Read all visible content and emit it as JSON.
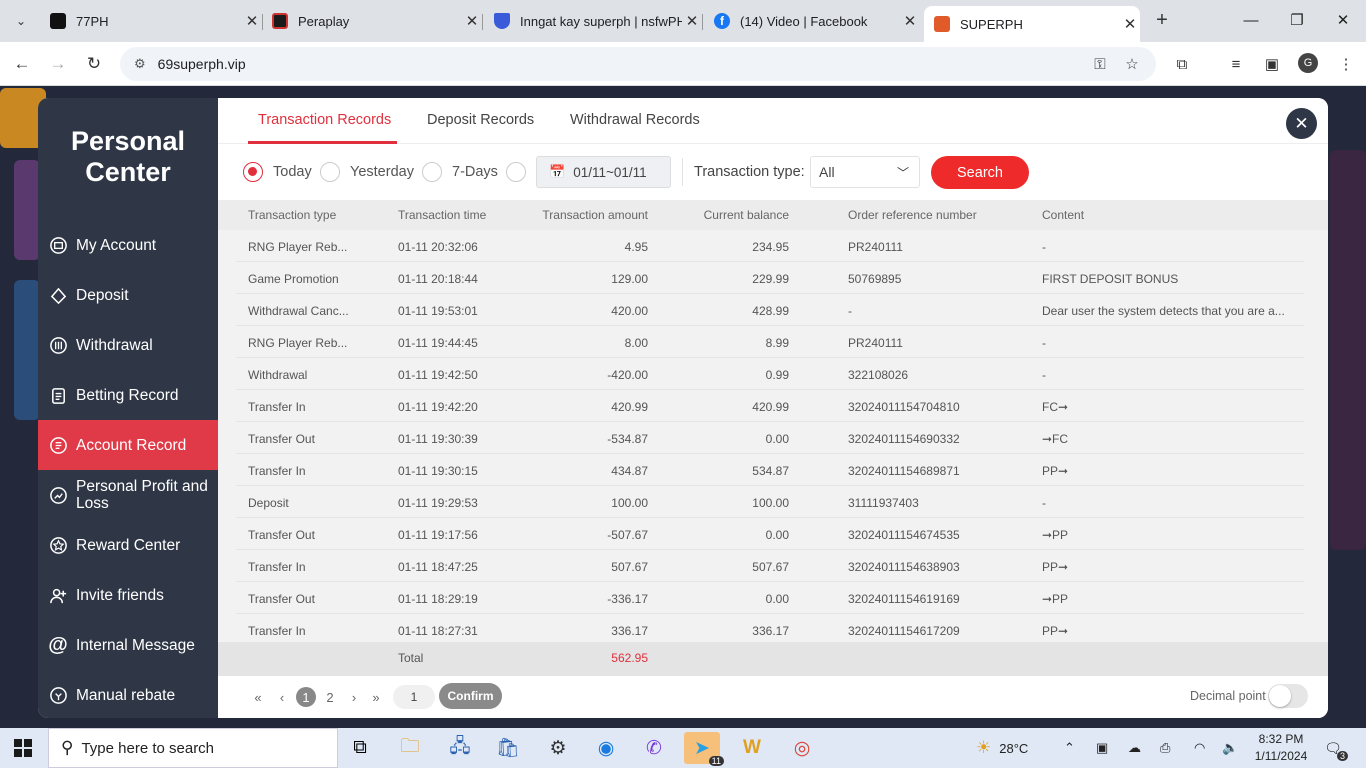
{
  "browser": {
    "tabs": [
      {
        "title": "77PH",
        "favicon_color": "#111111",
        "close": "✕"
      },
      {
        "title": "Peraplay",
        "favicon_color": "#1a1a1a",
        "close": "✕"
      },
      {
        "title": "Inngat kay superph | nsfwPH",
        "favicon_color": "#3a5bd9",
        "close": "✕"
      },
      {
        "title": "(14) Video | Facebook",
        "favicon_color": "#1877f2",
        "close": "✕"
      },
      {
        "title": "SUPERPH",
        "favicon_color": "#e05a2a",
        "close": "✕"
      }
    ],
    "url": "69superph.vip",
    "profile_initial": "G"
  },
  "modal": {
    "title_line1": "Personal",
    "title_line2": "Center",
    "menu": [
      {
        "label": "My Account",
        "icon": "wallet-icon"
      },
      {
        "label": "Deposit",
        "icon": "deposit-icon"
      },
      {
        "label": "Withdrawal",
        "icon": "withdrawal-icon"
      },
      {
        "label": "Betting Record",
        "icon": "clipboard-icon"
      },
      {
        "label": "Account Record",
        "icon": "record-icon",
        "active": true
      },
      {
        "label": "Personal Profit and Loss",
        "icon": "chart-icon"
      },
      {
        "label": "Reward Center",
        "icon": "star-icon"
      },
      {
        "label": "Invite friends",
        "icon": "invite-icon"
      },
      {
        "label": "Internal Message",
        "icon": "at-icon"
      },
      {
        "label": "Manual rebate",
        "icon": "rebate-icon"
      }
    ],
    "tabs": [
      "Transaction Records",
      "Deposit Records",
      "Withdrawal Records"
    ],
    "active_tab": "Transaction Records",
    "close": "✕"
  },
  "filters": {
    "periods": [
      "Today",
      "Yesterday",
      "7-Days"
    ],
    "selected_period": "Today",
    "date_range": "01/11~01/11",
    "type_label": "Transaction type:",
    "type_value": "All",
    "search_label": "Search"
  },
  "table": {
    "headers": [
      "Transaction type",
      "Transaction time",
      "Transaction amount",
      "Current balance",
      "Order reference number",
      "Content"
    ],
    "rows": [
      [
        "RNG Player Reb...",
        "01-11 20:32:06",
        "4.95",
        "234.95",
        "PR240111",
        "-"
      ],
      [
        "Game Promotion",
        "01-11 20:18:44",
        "129.00",
        "229.99",
        "50769895",
        "FIRST DEPOSIT BONUS"
      ],
      [
        "Withdrawal Canc...",
        "01-11 19:53:01",
        "420.00",
        "428.99",
        "-",
        "Dear user the system detects that you are a..."
      ],
      [
        "RNG Player Reb...",
        "01-11 19:44:45",
        "8.00",
        "8.99",
        "PR240111",
        "-"
      ],
      [
        "Withdrawal",
        "01-11 19:42:50",
        "-420.00",
        "0.99",
        "322108026",
        "-"
      ],
      [
        "Transfer In",
        "01-11 19:42:20",
        "420.99",
        "420.99",
        "32024011154704810",
        "FC➞"
      ],
      [
        "Transfer Out",
        "01-11 19:30:39",
        "-534.87",
        "0.00",
        "32024011154690332",
        "➞FC"
      ],
      [
        "Transfer In",
        "01-11 19:30:15",
        "434.87",
        "534.87",
        "32024011154689871",
        "PP➞"
      ],
      [
        "Deposit",
        "01-11 19:29:53",
        "100.00",
        "100.00",
        "31111937403",
        "-"
      ],
      [
        "Transfer Out",
        "01-11 19:17:56",
        "-507.67",
        "0.00",
        "32024011154674535",
        "➞PP"
      ],
      [
        "Transfer In",
        "01-11 18:47:25",
        "507.67",
        "507.67",
        "32024011154638903",
        "PP➞"
      ],
      [
        "Transfer Out",
        "01-11 18:29:19",
        "-336.17",
        "0.00",
        "32024011154619169",
        "➞PP"
      ],
      [
        "Transfer In",
        "01-11 18:27:31",
        "336.17",
        "336.17",
        "32024011154617209",
        "PP➞"
      ]
    ],
    "total_label": "Total",
    "total_value": "562.95",
    "total_color": "#e0303d"
  },
  "pager": {
    "pages": [
      "1",
      "2"
    ],
    "current": "1",
    "jump_value": "1",
    "confirm_label": "Confirm",
    "decimal_label": "Decimal point"
  },
  "taskbar": {
    "search_placeholder": "Type here to search",
    "weather": "28°C",
    "time": "8:32 PM",
    "date": "1/11/2024",
    "telegram_badge": "11",
    "notif_count": "3"
  },
  "colors": {
    "accent": "#e0303d",
    "sidebar": "#2f3645",
    "search_button": "#ee2a2a"
  }
}
